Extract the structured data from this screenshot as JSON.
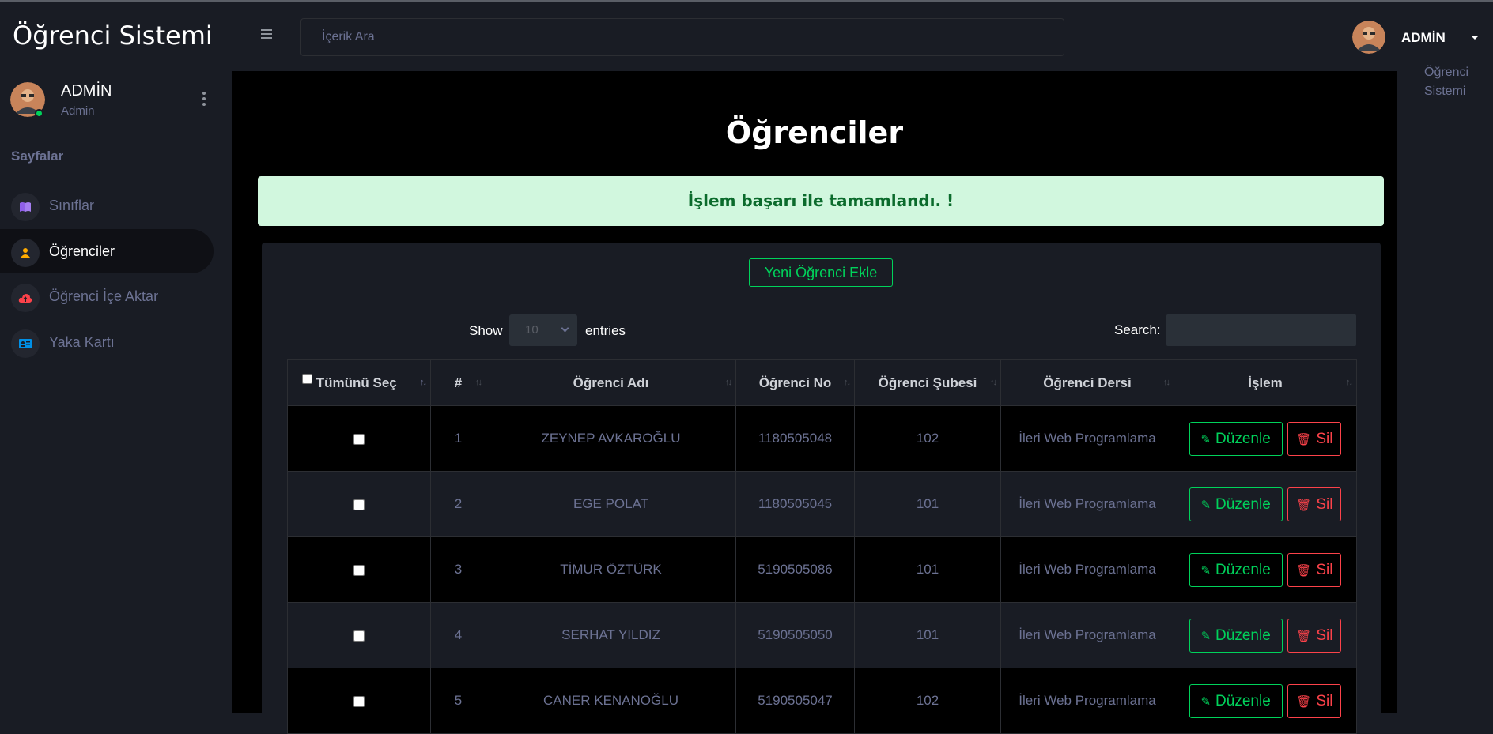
{
  "app": {
    "brand": "Öğrenci Sistemi"
  },
  "navbar": {
    "search_placeholder": "İçerik Ara",
    "user_name": "ADMİN"
  },
  "sidebar": {
    "user_name": "ADMİN",
    "user_role": "Admin",
    "category": "Sayfalar",
    "items": [
      {
        "label": "Sınıflar",
        "icon": "book-icon",
        "color": "#8f5fe8",
        "active": false
      },
      {
        "label": "Öğrenciler",
        "icon": "user-icon",
        "color": "#ffab00",
        "active": true
      },
      {
        "label": "Öğrenci İçe Aktar",
        "icon": "cloud-upload-icon",
        "color": "#fc424a",
        "active": false
      },
      {
        "label": "Yaka Kartı",
        "icon": "id-card-icon",
        "color": "#0090e7",
        "active": false
      }
    ]
  },
  "right_strip_text": [
    "Öğrenci",
    "Sistemi"
  ],
  "page": {
    "title": "Öğrenciler",
    "alert": "İşlem başarı ile tamamlandı. !",
    "add_button": "Yeni Öğrenci Ekle",
    "show_label": "Show",
    "page_length": "10",
    "entries_label": "entries",
    "search_label": "Search:"
  },
  "table": {
    "columns": [
      "Tümünü Seç",
      "#",
      "Öğrenci Adı",
      "Öğrenci No",
      "Öğrenci Şubesi",
      "Öğrenci Dersi",
      "İşlem"
    ],
    "edit_label": "Düzenle",
    "delete_label": "Sil",
    "rows": [
      {
        "no": "1",
        "name": "ZEYNEP AVKAROĞLU",
        "number": "1180505048",
        "branch": "102",
        "course": "İleri Web Programlama"
      },
      {
        "no": "2",
        "name": "EGE POLAT",
        "number": "1180505045",
        "branch": "101",
        "course": "İleri Web Programlama"
      },
      {
        "no": "3",
        "name": "TİMUR ÖZTÜRK",
        "number": "5190505086",
        "branch": "101",
        "course": "İleri Web Programlama"
      },
      {
        "no": "4",
        "name": "SERHAT YILDIZ",
        "number": "5190505050",
        "branch": "101",
        "course": "İleri Web Programlama"
      },
      {
        "no": "5",
        "name": "CANER KENANOĞLU",
        "number": "5190505047",
        "branch": "102",
        "course": "İleri Web Programlama"
      }
    ]
  }
}
